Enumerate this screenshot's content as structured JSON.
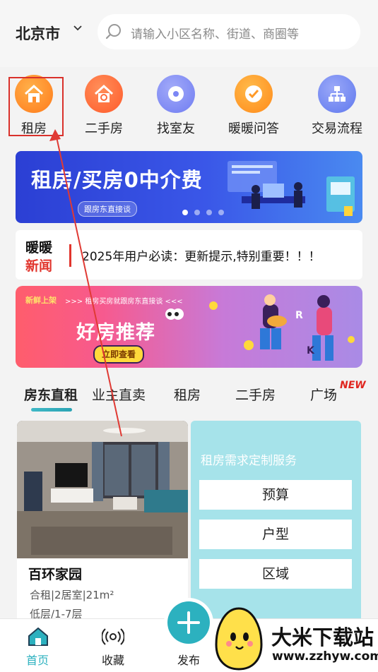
{
  "header": {
    "city": "北京市",
    "search_placeholder": "请输入小区名称、街道、商圈等"
  },
  "categories": [
    {
      "label": "租房",
      "icon": "house-icon",
      "color": "#ff8c2a"
    },
    {
      "label": "二手房",
      "icon": "refresh-house-icon",
      "color": "#ff6a3a"
    },
    {
      "label": "找室友",
      "icon": "disc-icon",
      "color": "#7b86f5"
    },
    {
      "label": "暖暖问答",
      "icon": "check-icon",
      "color": "#ff9a28"
    },
    {
      "label": "交易流程",
      "icon": "flowchart-icon",
      "color": "#6f86f0"
    }
  ],
  "banner1": {
    "title": "租房/买房0中介费",
    "subtitle": "跟房东直接谈"
  },
  "news": {
    "label_line1": "暖暖",
    "label_line2": "新闻",
    "headline": "2025年用户必读：更新提示,特别重要！！！"
  },
  "banner2": {
    "tag": "新鲜上架",
    "tagline": ">>> 租房买房就跟房东直接谈 <<<",
    "title": "好房推荐",
    "button": "立即查看"
  },
  "tabs": [
    {
      "label": "房东直租",
      "active": true
    },
    {
      "label": "业主直卖",
      "active": false
    },
    {
      "label": "租房",
      "active": false
    },
    {
      "label": "二手房",
      "active": false
    },
    {
      "label": "广场",
      "active": false
    }
  ],
  "new_badge": "NEW",
  "listing": {
    "name": "百环家园",
    "desc": "合租|2居室|21m²",
    "floor": "低层/1-7层"
  },
  "custom_service": {
    "title": "租房需求定制服务",
    "options": [
      "预算",
      "户型",
      "区域"
    ]
  },
  "bottom_nav": [
    {
      "label": "首页",
      "icon": "home-icon",
      "active": true
    },
    {
      "label": "收藏",
      "icon": "signal-icon",
      "active": false
    },
    {
      "label": "发布",
      "icon": "plus-icon",
      "active": false
    }
  ],
  "watermark": {
    "name": "大米下载站",
    "url": "www.zzhyw.com"
  },
  "colors": {
    "accent": "#2cb1bf",
    "highlight_red": "#d9312b",
    "news_red": "#e1352d"
  }
}
